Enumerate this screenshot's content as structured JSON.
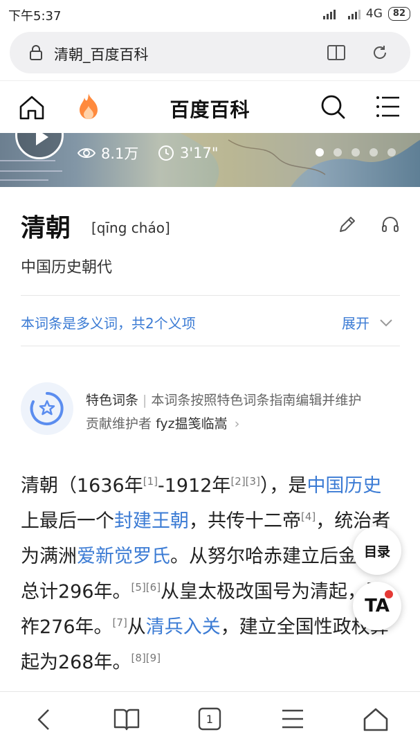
{
  "status_bar": {
    "time": "下午5:37",
    "network": "4G",
    "battery": "82"
  },
  "address_bar": {
    "url_title": "清朝_百度百科"
  },
  "site_header": {
    "brand": "百度百科"
  },
  "banner": {
    "views": "8.1万",
    "duration": "3'17\"",
    "slide_count": 5,
    "active_slide": 1
  },
  "entry": {
    "title": "清朝",
    "pinyin": "[qīng cháo]",
    "subtitle": "中国历史朝代",
    "polysemy_text": "本词条是多义词，共2个义项",
    "expand_label": "展开"
  },
  "featured": {
    "label": "特色词条",
    "separator": "|",
    "description": "本词条按照特色词条指南编辑并维护",
    "contributor_prefix": "贡献维护者",
    "contributor_name": "fyz揾笺临嵩",
    "arrow": "›"
  },
  "article": {
    "t1": "清朝（1636年",
    "r1": "[1]",
    "t2": "-1912年",
    "r2": "[2][3]",
    "t3": "），是",
    "link1": "中国历史",
    "t4": "上最后一个",
    "link2": "封建王朝",
    "t5": "，共传十二帝",
    "r3": "[4]",
    "t6": "，统治者为满洲",
    "link3": "爱新觉罗氏",
    "t7": "。从努尔哈赤建立后金起，总计296年。",
    "r4": "[5][6]",
    "t8": "从皇太极改国号为清起，国祚276年。",
    "r5": "[7]",
    "t9": "从",
    "link4": "清兵入关",
    "t10": "，建立全国性政权算起为268年。",
    "r6": "[8][9]"
  },
  "floating": {
    "toc_label": "目录",
    "ta_label": "TA"
  },
  "bottom_nav": {
    "tab_count": "1"
  },
  "colors": {
    "link": "#3b7bd4",
    "fire": "#ff8a3d",
    "badge": "#e53935"
  }
}
